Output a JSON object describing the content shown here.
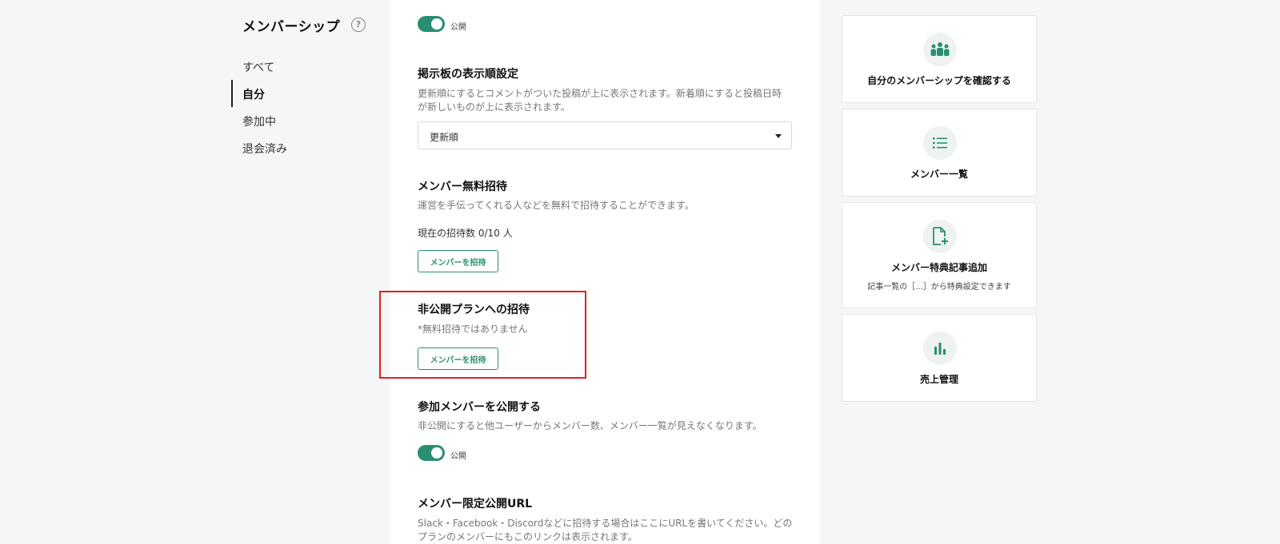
{
  "nav": {
    "title": "メンバーシップ",
    "help_icon": "question-circle-icon",
    "items": [
      {
        "label": "すべて"
      },
      {
        "label": "自分"
      },
      {
        "label": "参加中"
      },
      {
        "label": "退会済み"
      }
    ],
    "active_item": "自分"
  },
  "settings": {
    "top_toggle": {
      "state_label": "公開",
      "on": true
    },
    "board_order": {
      "title": "掲示板の表示順設定",
      "description_line1": "更新順にするとコメントがついた投稿が上に表示されます。新着順にすると投稿日時",
      "description_line2": "が新しいものが上に表示されます。",
      "selected": "更新順"
    },
    "free_invite": {
      "title": "メンバー無料招待",
      "description": "運営を手伝ってくれる人などを無料で招待することができます。",
      "count_text": "現在の招待数 0/10 人",
      "button_label": "メンバーを招待"
    },
    "private_invite": {
      "title": "非公開プランへの招待",
      "note": "*無料招待ではありません",
      "button_label": "メンバーを招待"
    },
    "publish_members": {
      "title": "参加メンバーを公開する",
      "description": "非公開にすると他ユーザーからメンバー数、メンバー一覧が見えなくなります。",
      "state_label": "公開",
      "on": true
    },
    "member_url": {
      "title": "メンバー限定公開URL",
      "description_line1": "Slack・Facebook・Discordなどに招待する場合はここにURLを書いてください。どの",
      "description_line2": "プランのメンバーにもこのリンクは表示されます。"
    }
  },
  "cards": [
    {
      "icon": "group-icon",
      "label": "自分のメンバーシップを確認する"
    },
    {
      "icon": "list-icon",
      "label": "メンバー一覧"
    },
    {
      "icon": "add-file-icon",
      "label": "メンバー特典記事追加",
      "sublabel": "記事一覧の［...］から特典設定できます"
    },
    {
      "icon": "bar-chart-icon",
      "label": "売上管理"
    }
  ],
  "colors": {
    "accent": "#2a8f72",
    "highlight": "#e02020",
    "background": "#f4f6f8"
  }
}
